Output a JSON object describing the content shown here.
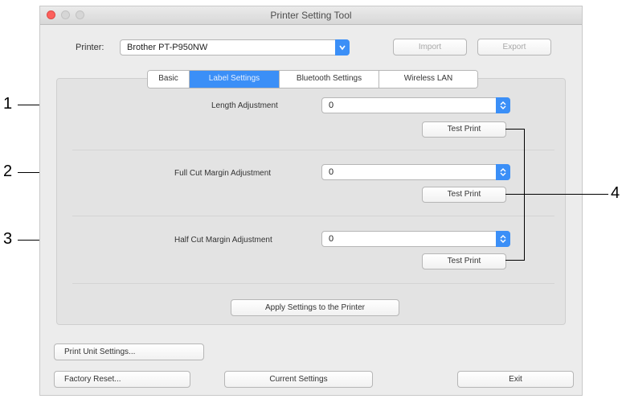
{
  "window": {
    "title": "Printer Setting Tool"
  },
  "printer": {
    "label": "Printer:",
    "selected": "Brother PT-P950NW"
  },
  "toolbar": {
    "import_label": "Import",
    "export_label": "Export"
  },
  "tabs": [
    {
      "label": "Basic",
      "active": false
    },
    {
      "label": "Label Settings",
      "active": true
    },
    {
      "label": "Bluetooth Settings",
      "active": false
    },
    {
      "label": "Wireless LAN",
      "active": false
    }
  ],
  "settings": [
    {
      "label": "Length Adjustment",
      "value": "0",
      "test_print_label": "Test Print"
    },
    {
      "label": "Full Cut Margin Adjustment",
      "value": "0",
      "test_print_label": "Test Print"
    },
    {
      "label": "Half Cut Margin Adjustment",
      "value": "0",
      "test_print_label": "Test Print"
    }
  ],
  "apply_label": "Apply Settings to the Printer",
  "bottom": {
    "print_unit_label": "Print Unit Settings...",
    "factory_reset_label": "Factory Reset...",
    "current_settings_label": "Current Settings",
    "exit_label": "Exit"
  },
  "callouts": [
    "1",
    "2",
    "3",
    "4"
  ],
  "colors": {
    "accent": "#3b8ff7",
    "close_button": "#fc605c",
    "window_bg": "#ececec"
  }
}
